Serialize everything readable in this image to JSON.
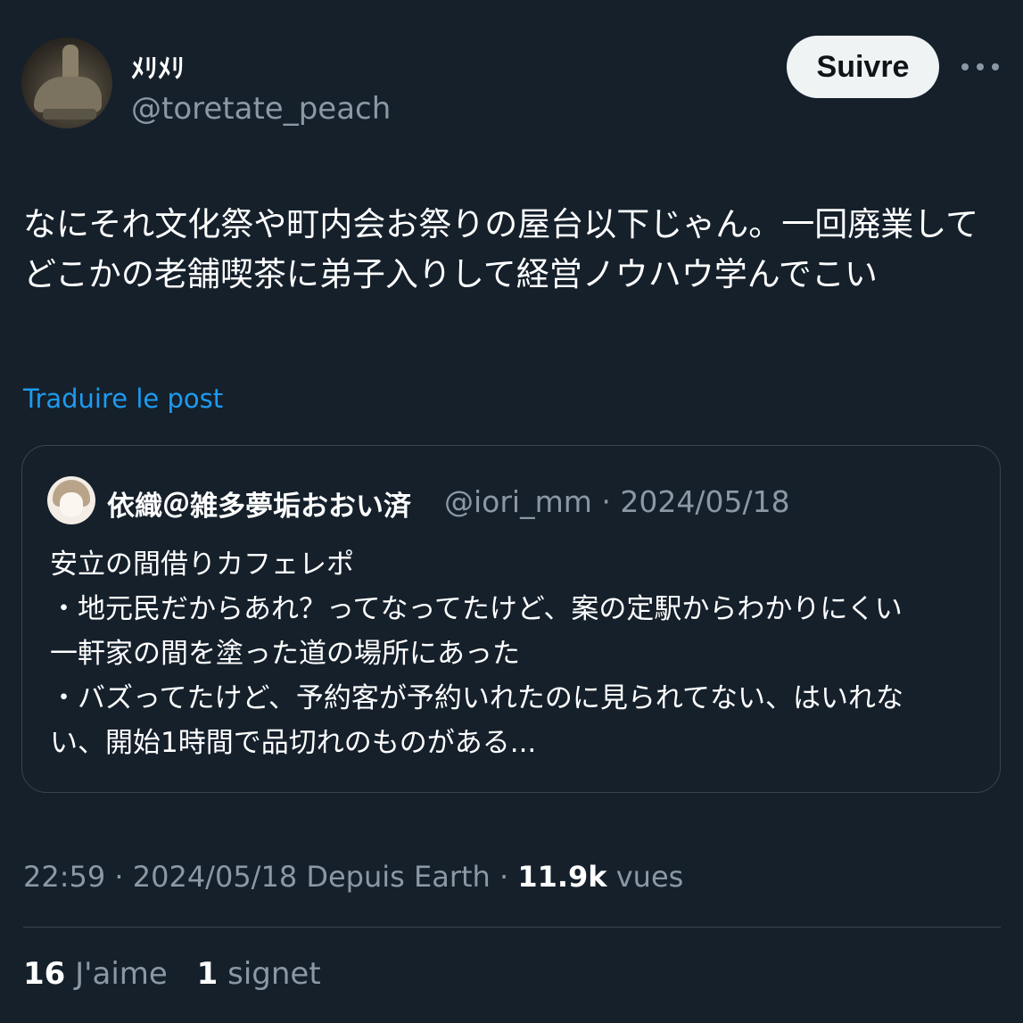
{
  "author": {
    "display_name": "ﾒﾘﾒﾘ",
    "handle": "@toretate_peach"
  },
  "follow_button": "Suivre",
  "post": {
    "text": "なにそれ文化祭や町内会お祭りの屋台以下じゃん。一回廃業して\nどこかの老舗喫茶に弟子入りして経営ノウハウ学んでこい",
    "translate_link": "Traduire le post"
  },
  "quote": {
    "display_name": "依織＠雑多夢垢おおい済",
    "handle": "@iori_mm",
    "separator": " · ",
    "date": "2024/05/18",
    "text": "安立の間借りカフェレポ\n・地元民だからあれ？ってなってたけど、案の定駅からわかりにくい\n一軒家の間を塗った道の場所にあった\n・バズってたけど、予約客が予約いれたのに見られてない、はいれな\nい、開始1時間で品切れのものがある..."
  },
  "meta": {
    "time": "22:59",
    "sep1": " · ",
    "date": "2024/05/18",
    "source": " Depuis Earth",
    "sep2": " · ",
    "views_count": "11.9k",
    "views_label": " vues"
  },
  "stats": {
    "likes_count": "16",
    "likes_label": "J'aime",
    "bookmarks_count": "1",
    "bookmarks_label": "signet"
  }
}
